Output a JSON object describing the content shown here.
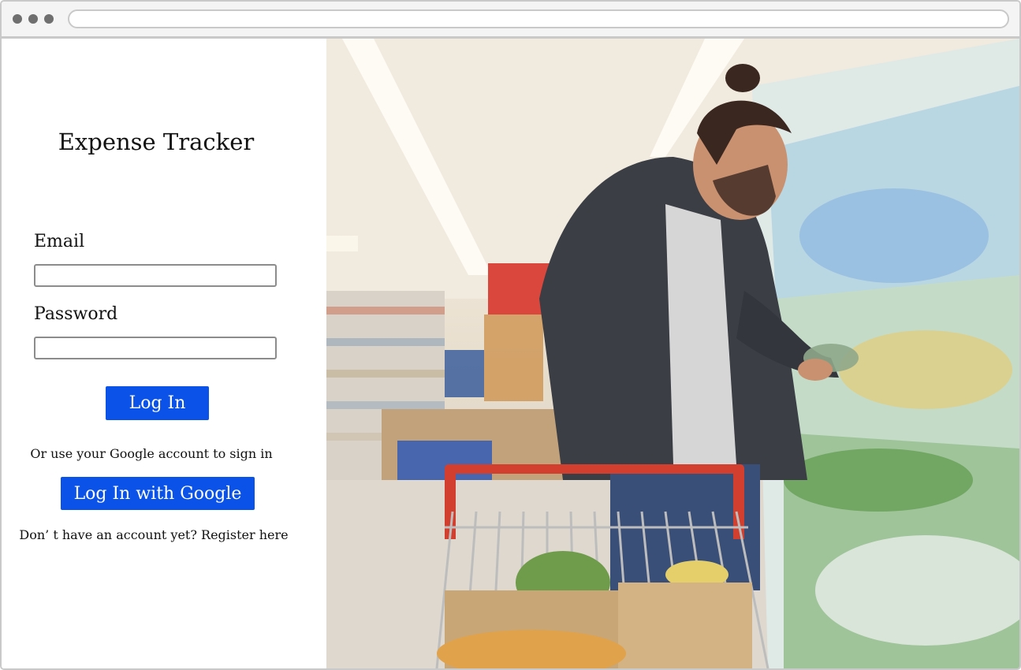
{
  "browser": {
    "address_bar_value": ""
  },
  "login": {
    "app_title": "Expense Tracker",
    "email_label": "Email",
    "email_value": "",
    "password_label": "Password",
    "password_value": "",
    "login_button": "Log In",
    "alt_text": "Or use your Google account to sign in",
    "google_button": "Log In with Google",
    "register_text": "Don’  t have an account yet? Register here"
  },
  "hero": {
    "image": "supermarket-shopper-photo"
  },
  "colors": {
    "primary_button": "#0b53e8",
    "window_border": "#c9c9c9"
  }
}
